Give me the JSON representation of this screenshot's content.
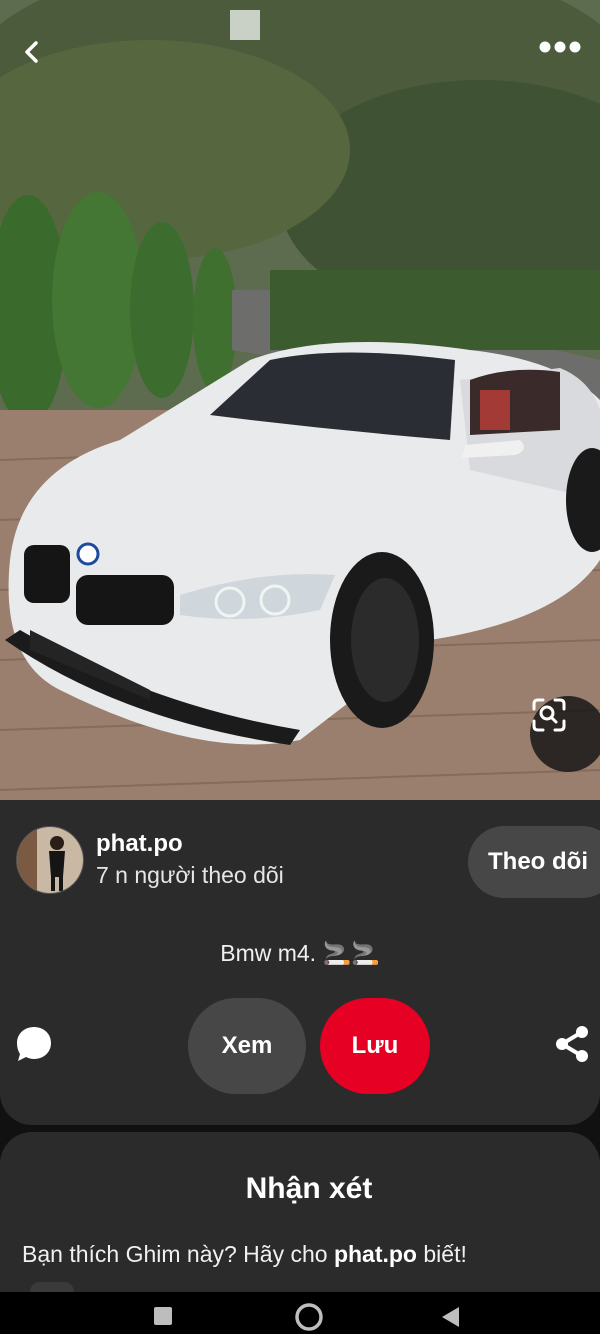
{
  "pin": {
    "image_alt": "BMW M4",
    "title": "Bmw m4. 🚬🚬"
  },
  "author": {
    "name": "phat.po",
    "followers_text": "7 n người theo dõi",
    "follow_label": "Theo dõi"
  },
  "actions": {
    "view_label": "Xem",
    "save_label": "Lưu"
  },
  "comments": {
    "title": "Nhận xét",
    "prompt_before": "Bạn thích Ghim này? Hãy cho ",
    "prompt_user": "phat.po",
    "prompt_after": " biết!"
  },
  "icons": {
    "back": "chevron-left-icon",
    "more": "more-dots-icon",
    "lens": "visual-search-icon",
    "comment": "speech-bubble-icon",
    "share": "share-icon",
    "nav_recent": "square-icon",
    "nav_home": "circle-icon",
    "nav_back": "triangle-back-icon"
  },
  "colors": {
    "save": "#e60023",
    "card": "#2b2b2b",
    "pill": "#474747"
  }
}
